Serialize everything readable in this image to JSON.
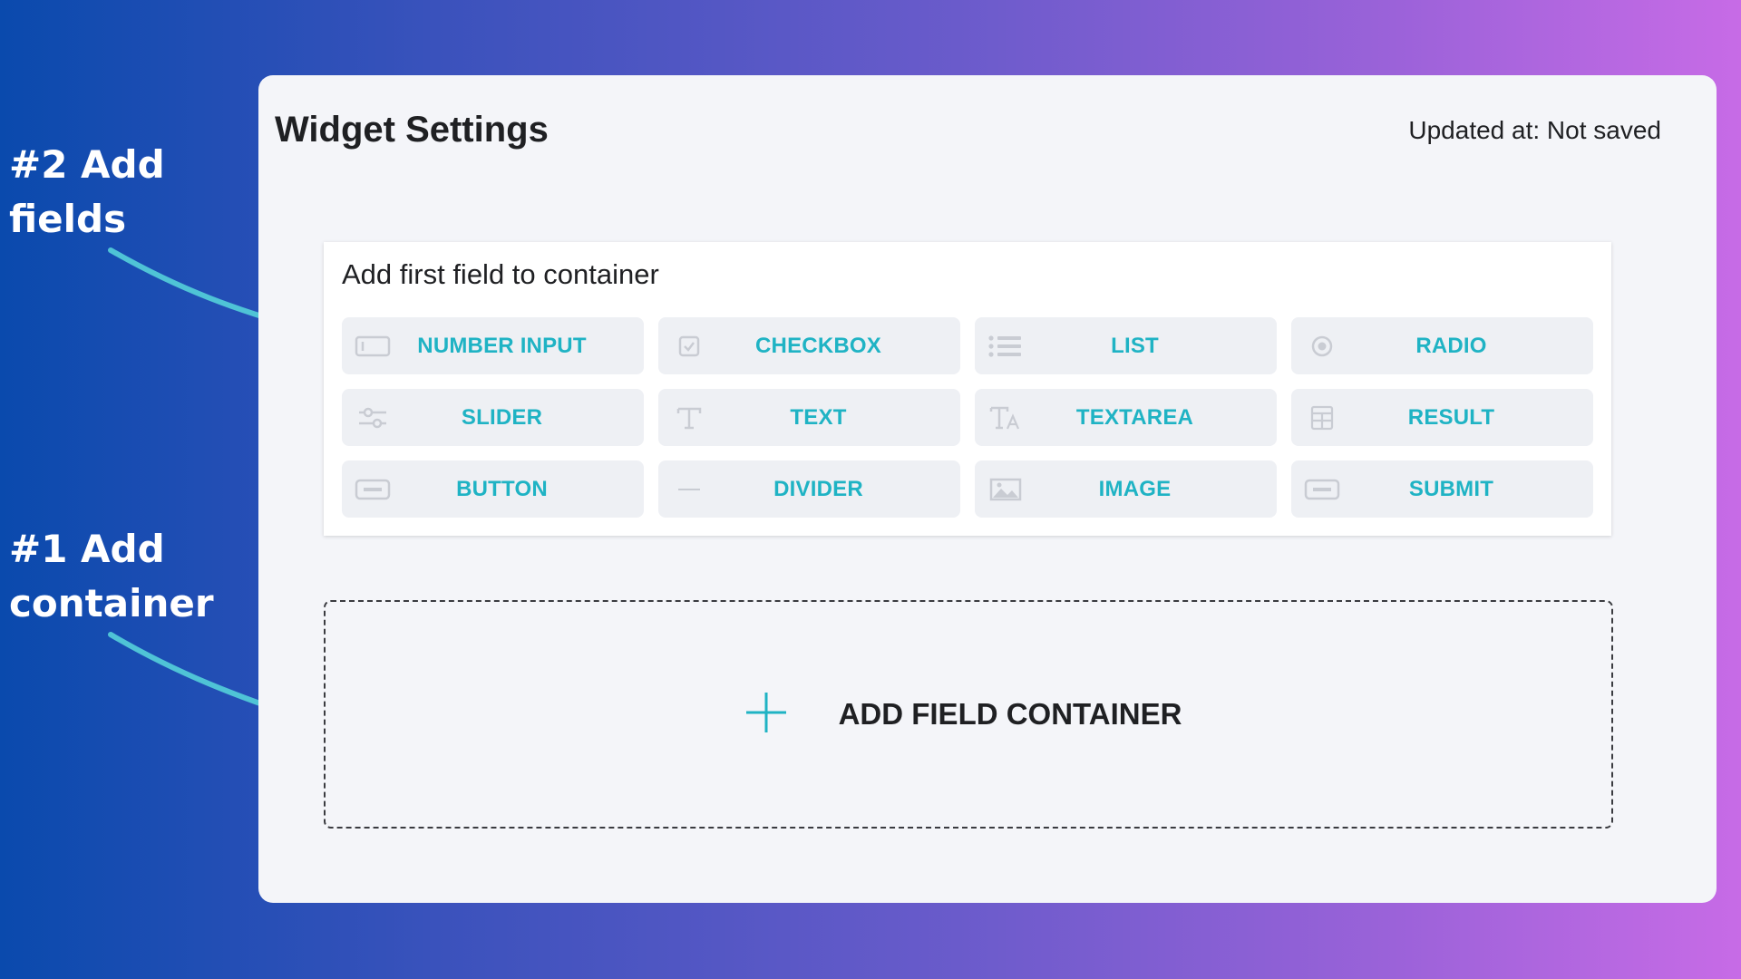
{
  "annotations": {
    "step2": [
      "#2 Add",
      "fields"
    ],
    "step1": [
      "#1 Add",
      "container"
    ]
  },
  "panel": {
    "title": "Widget Settings",
    "updated_text": "Updated at: Not saved"
  },
  "field_card": {
    "heading": "Add first field to container",
    "fields": [
      {
        "label": "NUMBER INPUT",
        "icon": "number-input-icon"
      },
      {
        "label": "CHECKBOX",
        "icon": "checkbox-icon"
      },
      {
        "label": "LIST",
        "icon": "list-icon"
      },
      {
        "label": "RADIO",
        "icon": "radio-icon"
      },
      {
        "label": "SLIDER",
        "icon": "slider-icon"
      },
      {
        "label": "TEXT",
        "icon": "text-icon"
      },
      {
        "label": "TEXTAREA",
        "icon": "textarea-icon"
      },
      {
        "label": "RESULT",
        "icon": "result-icon"
      },
      {
        "label": "BUTTON",
        "icon": "button-icon"
      },
      {
        "label": "DIVIDER",
        "icon": "divider-icon"
      },
      {
        "label": "IMAGE",
        "icon": "image-icon"
      },
      {
        "label": "SUBMIT",
        "icon": "submit-icon"
      }
    ]
  },
  "add_container": {
    "label": "ADD FIELD CONTAINER",
    "icon": "plus-icon"
  },
  "colors": {
    "accent": "#1fb3c4",
    "arrow": "#4fc3d6",
    "icon_gray": "#c9ccd3",
    "panel_bg": "#f4f5f9",
    "text_dark": "#1f2023"
  }
}
